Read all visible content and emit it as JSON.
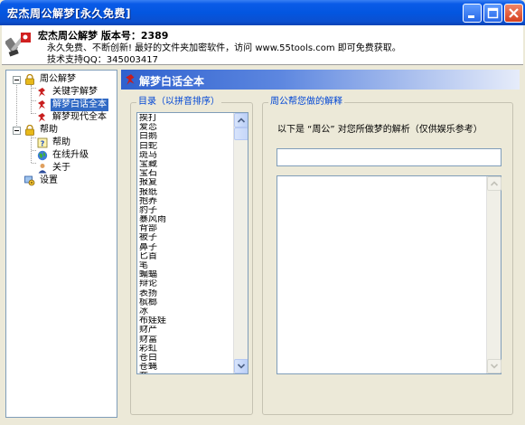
{
  "window": {
    "title": "宏杰周公解梦[永久免费]"
  },
  "header": {
    "app_name": "宏杰周公解梦   版本号：2389",
    "description": "永久免费、不断创新! 最好的文件夹加密软件，访问 www.55tools.com 即可免费获取。",
    "support": "技术支持QQ：345003417"
  },
  "tree": {
    "zhougong": "周公解梦",
    "keyword": "关键字解梦",
    "baihua": "解梦白话全本",
    "modern": "解梦现代全本",
    "help_group": "帮助",
    "help": "帮助",
    "upgrade": "在线升级",
    "about": "关于",
    "settings": "设置"
  },
  "panel": {
    "title": "解梦白话全本",
    "index_legend": "目录（以拼音排序）",
    "explain_legend": "周公帮您做的解释",
    "result_note": "以下是 “周公” 对您所做梦的解析（仅供娱乐参考）",
    "query_value": "",
    "explain_text": ""
  },
  "index_items": [
    "挨打",
    "爱恋",
    "白鹅",
    "白蛇",
    "斑马",
    "宝藏",
    "宝石",
    "报复",
    "报纸",
    "抱养",
    "豹子",
    "暴风雨",
    "背部",
    "被子",
    "鼻子",
    "匕首",
    "笔",
    "蝙蝠",
    "辩论",
    "表扬",
    "槟榔",
    "冰",
    "布娃娃",
    "财产",
    "财富",
    "彩虹",
    "苍白",
    "苍蝇",
    "蚕"
  ],
  "colors": {
    "selection": "#316AC5",
    "legend": "#0046D5",
    "titlebar": "#0356E0"
  }
}
